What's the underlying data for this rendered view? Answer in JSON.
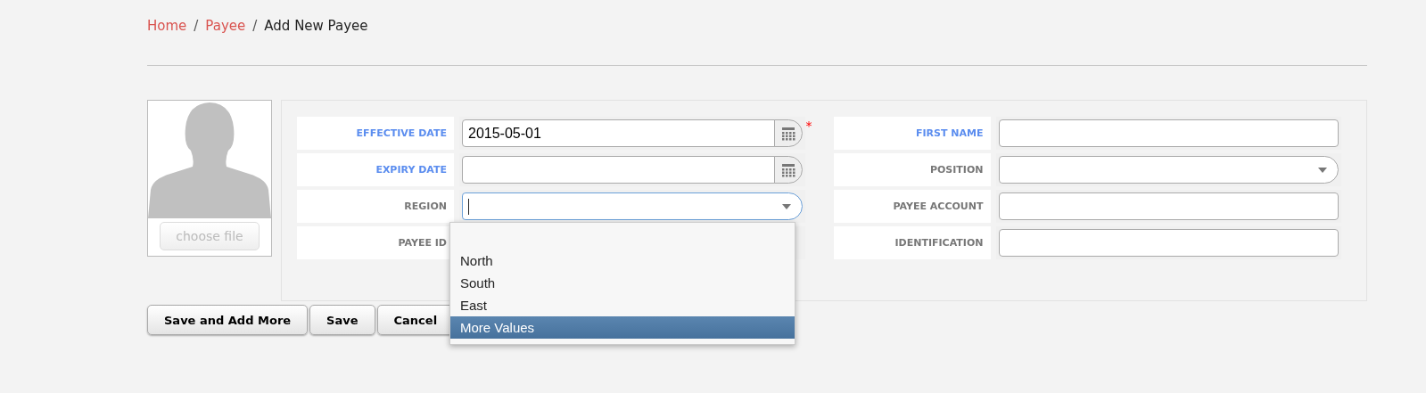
{
  "breadcrumb_separator": "/",
  "required_mark": "*",
  "breadcrumb": [
    {
      "label": "Home",
      "link": true
    },
    {
      "label": "Payee",
      "link": true
    },
    {
      "label": "Add New Payee",
      "link": false
    }
  ],
  "photo": {
    "button": "choose file"
  },
  "left_fields": [
    {
      "label": "EFFECTIVE DATE",
      "highlighted": true,
      "kind": "date",
      "value": "2015-05-01",
      "required": true
    },
    {
      "label": "EXPIRY DATE",
      "highlighted": true,
      "kind": "date",
      "required": false
    },
    {
      "label": "REGION",
      "highlighted": false,
      "kind": "select",
      "focused": true
    },
    {
      "label": "PAYEE ID",
      "highlighted": false,
      "kind": "covered"
    }
  ],
  "right_fields": [
    {
      "label": "FIRST NAME",
      "highlighted": true,
      "kind": "text"
    },
    {
      "label": "POSITION",
      "highlighted": false,
      "kind": "select",
      "focused": false
    },
    {
      "label": "PAYEE ACCOUNT",
      "highlighted": false,
      "kind": "text"
    },
    {
      "label": "IDENTIFICATION",
      "highlighted": false,
      "kind": "text"
    }
  ],
  "region_options": [
    {
      "label": "North",
      "selected": false
    },
    {
      "label": "South",
      "selected": false
    },
    {
      "label": "East",
      "selected": false
    },
    {
      "label": "More Values",
      "selected": true
    }
  ],
  "buttons": [
    "Save and Add More",
    "Save",
    "Cancel"
  ]
}
